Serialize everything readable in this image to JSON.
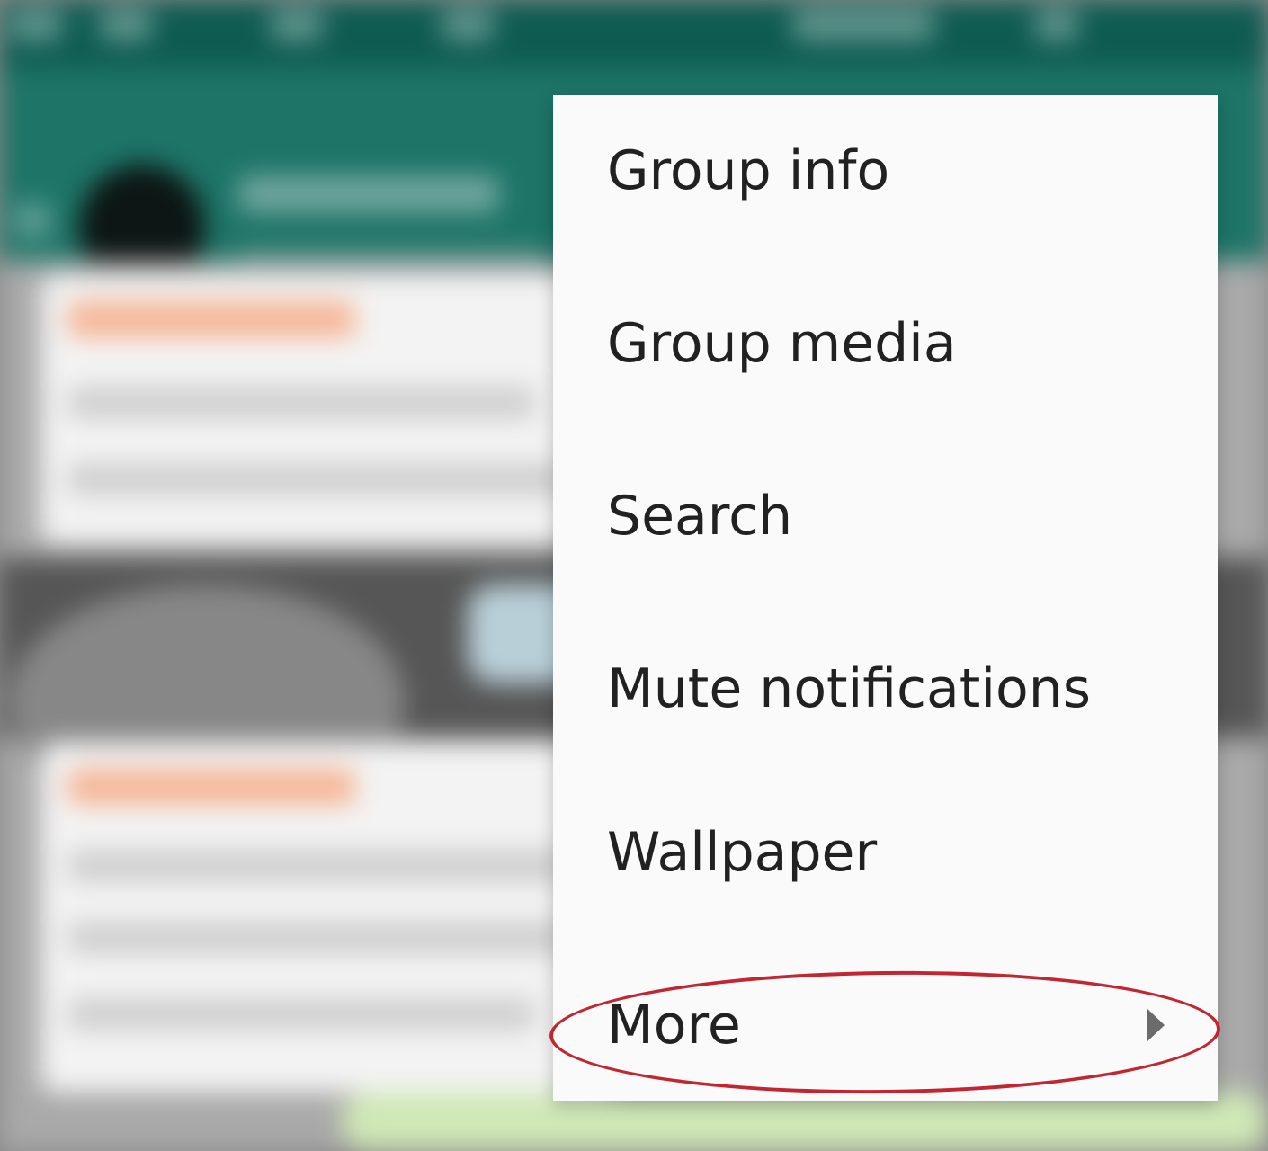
{
  "menu": {
    "items": [
      {
        "label": "Group info",
        "name": "menu-item-group-info"
      },
      {
        "label": "Group media",
        "name": "menu-item-group-media"
      },
      {
        "label": "Search",
        "name": "menu-item-search"
      },
      {
        "label": "Mute notifications",
        "name": "menu-item-mute-notifications"
      },
      {
        "label": "Wallpaper",
        "name": "menu-item-wallpaper"
      },
      {
        "label": "More",
        "name": "menu-item-more",
        "submenu_icon": "chevron-right-icon"
      }
    ]
  },
  "annotation": {
    "color": "#c12632",
    "target": "More"
  },
  "theme": {
    "toolbar_color": "#1d7467",
    "statusbar_color": "#0e5b52",
    "menu_background": "#fafafa",
    "menu_text_color": "#212121"
  }
}
